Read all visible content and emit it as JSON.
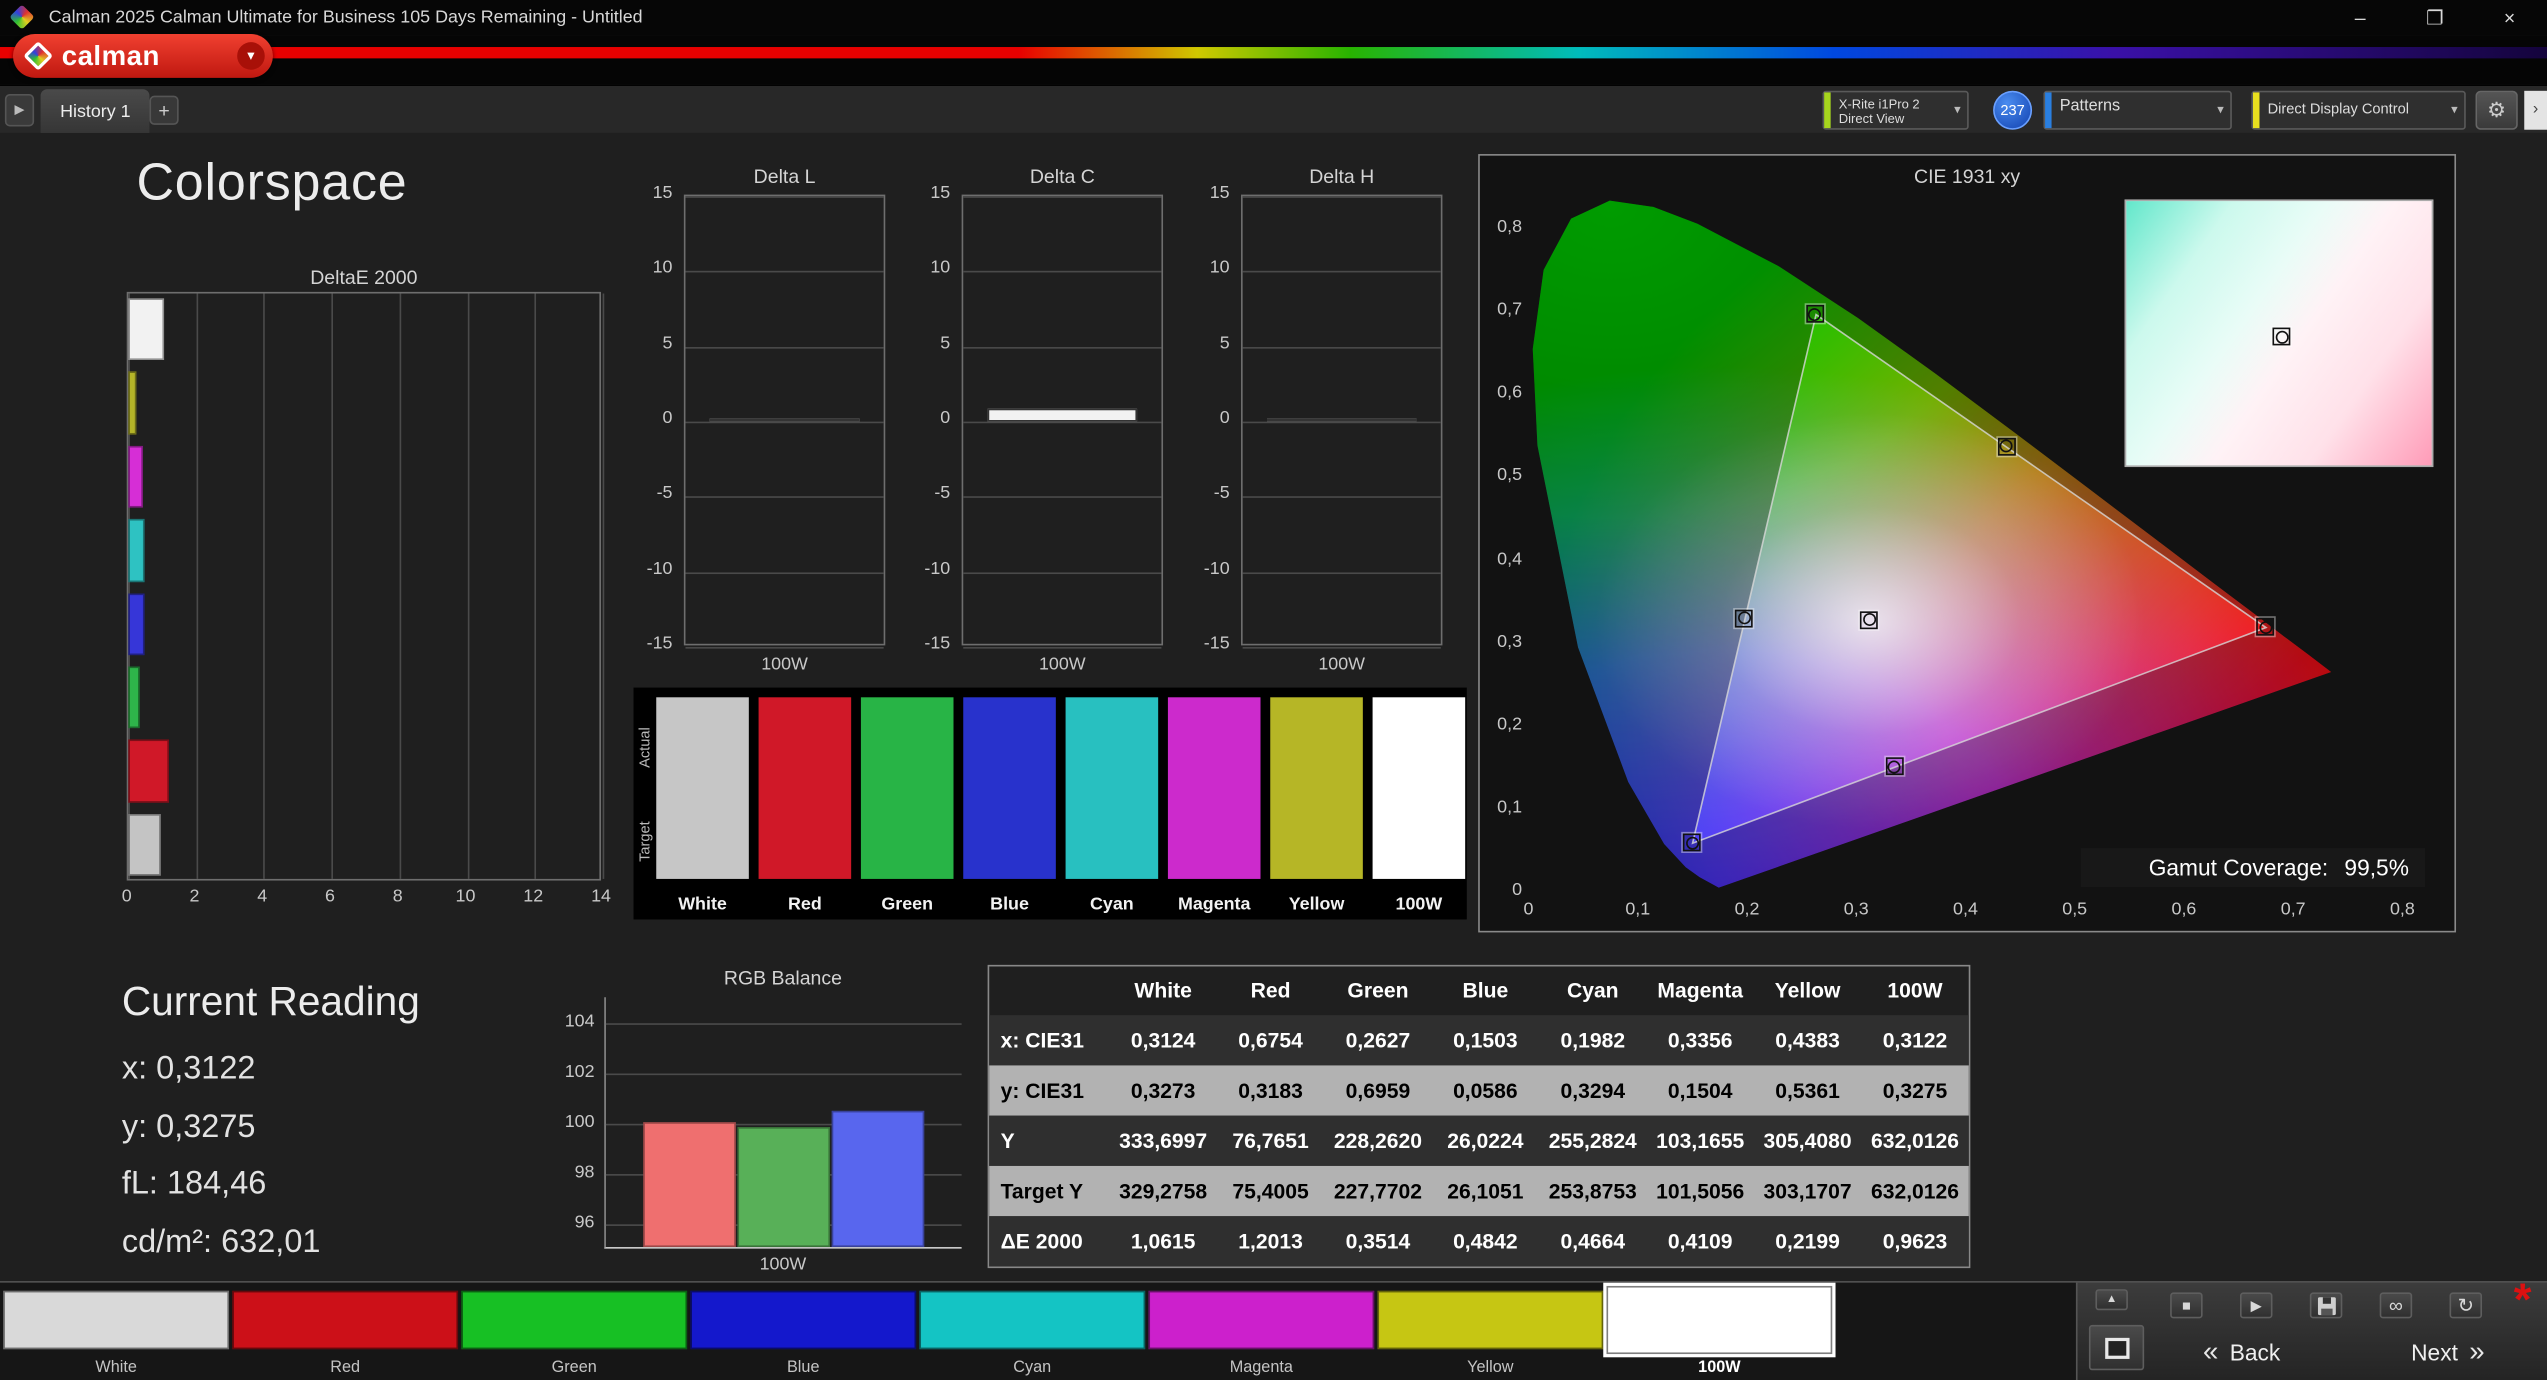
{
  "colors": {
    "accent_red": "#d62e20",
    "badge_blue": "#1e62d8",
    "meter_accent": "#a6d51e",
    "patterns_accent": "#2a7fe0",
    "display_accent": "#e8df1f"
  },
  "icons": {
    "chevron_down": "▾",
    "plus": "+",
    "panel_arrow": "▶",
    "gear": "⚙",
    "overflow": "›",
    "minimize": "–",
    "maximize": "❐",
    "close": "×",
    "up": "▲",
    "stop": "■",
    "play": "▶",
    "link": "∞",
    "refresh": "↻",
    "asterisk": "*",
    "back_chevron": "«",
    "next_chevron": "»"
  },
  "titlebar": {
    "title": "Calman 2025 Calman Ultimate for Business 105 Days Remaining  - Untitled"
  },
  "header": {
    "logo_text": "calman"
  },
  "tabbar": {
    "tab_label": "History 1",
    "meter_line1": "X-Rite i1Pro 2",
    "meter_line2": "Direct View",
    "meter_badge": "237",
    "patterns_label": "Patterns",
    "display_label": "Direct Display Control"
  },
  "page_title": "Colorspace",
  "swatch_strip": {
    "row_labels": [
      "Actual",
      "Target"
    ],
    "columns": [
      {
        "label": "White",
        "color": "#c6c6c6"
      },
      {
        "label": "Red",
        "color": "#d01828"
      },
      {
        "label": "Green",
        "color": "#28b446"
      },
      {
        "label": "Blue",
        "color": "#2832cc"
      },
      {
        "label": "Cyan",
        "color": "#28c0c0"
      },
      {
        "label": "Magenta",
        "color": "#cc2acc"
      },
      {
        "label": "Yellow",
        "color": "#b6b626"
      },
      {
        "label": "100W",
        "color": "#ffffff"
      }
    ]
  },
  "current_reading": {
    "title": "Current Reading",
    "x": "x: 0,3122",
    "y": "y: 0,3275",
    "fl": "fL: 184,46",
    "cd": "cd/m²: 632,01"
  },
  "table": {
    "columns": [
      "White",
      "Red",
      "Green",
      "Blue",
      "Cyan",
      "Magenta",
      "Yellow",
      "100W"
    ],
    "rows": [
      {
        "label": "x: CIE31",
        "values": [
          "0,3124",
          "0,6754",
          "0,2627",
          "0,1503",
          "0,1982",
          "0,3356",
          "0,4383",
          "0,3122"
        ]
      },
      {
        "label": "y: CIE31",
        "values": [
          "0,3273",
          "0,3183",
          "0,6959",
          "0,0586",
          "0,3294",
          "0,1504",
          "0,5361",
          "0,3275"
        ]
      },
      {
        "label": "Y",
        "values": [
          "333,6997",
          "76,7651",
          "228,2620",
          "26,0224",
          "255,2824",
          "103,1655",
          "305,4080",
          "632,0126"
        ]
      },
      {
        "label": "Target Y",
        "values": [
          "329,2758",
          "75,4005",
          "227,7702",
          "26,1051",
          "253,8753",
          "101,5056",
          "303,1707",
          "632,0126"
        ]
      },
      {
        "label": "ΔE 2000",
        "values": [
          "1,0615",
          "1,2013",
          "0,3514",
          "0,4842",
          "0,4664",
          "0,4109",
          "0,2199",
          "0,9623"
        ]
      }
    ]
  },
  "bottom_bar": {
    "swatches": [
      {
        "label": "White",
        "color": "#d9d9d9",
        "selected": false
      },
      {
        "label": "Red",
        "color": "#cc1018",
        "selected": false
      },
      {
        "label": "Green",
        "color": "#17c024",
        "selected": false
      },
      {
        "label": "Blue",
        "color": "#1418cc",
        "selected": false
      },
      {
        "label": "Cyan",
        "color": "#14c4c4",
        "selected": false
      },
      {
        "label": "Magenta",
        "color": "#cc20cc",
        "selected": false
      },
      {
        "label": "Yellow",
        "color": "#c6c613",
        "selected": false
      },
      {
        "label": "100W",
        "color": "#ffffff",
        "selected": true
      }
    ],
    "back_label": "Back",
    "next_label": "Next"
  },
  "chart_data": [
    {
      "id": "deltae",
      "type": "bar",
      "title": "DeltaE 2000",
      "categories": [
        "White",
        "Yellow",
        "Magenta",
        "Cyan",
        "Blue",
        "Green",
        "Red",
        "100W"
      ],
      "values": [
        1.0615,
        0.2199,
        0.4109,
        0.4664,
        0.4842,
        0.3514,
        1.2013,
        0.9623
      ],
      "bar_colors": [
        "#f2f2f2",
        "#b4b428",
        "#d62ed6",
        "#2ec2c2",
        "#3636d8",
        "#2eb44a",
        "#d01828",
        "#c4c4c4"
      ],
      "xlim": [
        0,
        14
      ],
      "x_ticks": [
        0,
        2,
        4,
        6,
        8,
        10,
        12,
        14
      ]
    },
    {
      "id": "delta_l",
      "type": "bar",
      "title": "Delta L",
      "categories": [
        "100W"
      ],
      "values": [
        0.05
      ],
      "ylim": [
        -15,
        15
      ],
      "y_ticks": [
        15,
        10,
        5,
        0,
        -5,
        -10,
        -15
      ],
      "xlabel": "100W"
    },
    {
      "id": "delta_c",
      "type": "bar",
      "title": "Delta C",
      "categories": [
        "100W"
      ],
      "values": [
        0.9
      ],
      "ylim": [
        -15,
        15
      ],
      "y_ticks": [
        15,
        10,
        5,
        0,
        -5,
        -10,
        -15
      ],
      "xlabel": "100W"
    },
    {
      "id": "delta_h",
      "type": "bar",
      "title": "Delta H",
      "categories": [
        "100W"
      ],
      "values": [
        0.1
      ],
      "ylim": [
        -15,
        15
      ],
      "y_ticks": [
        15,
        10,
        5,
        0,
        -5,
        -10,
        -15
      ],
      "xlabel": "100W"
    },
    {
      "id": "rgb_balance",
      "type": "bar",
      "title": "RGB Balance",
      "categories": [
        "Red",
        "Green",
        "Blue"
      ],
      "values": [
        100.0,
        99.8,
        100.45
      ],
      "bar_colors": [
        "#ef6f6f",
        "#58b058",
        "#5866ee"
      ],
      "ylim": [
        95,
        105
      ],
      "y_ticks": [
        104,
        102,
        100,
        98,
        96
      ],
      "xlabel": "100W"
    },
    {
      "id": "cie",
      "type": "scatter",
      "title": "CIE 1931 xy",
      "xlim": [
        0,
        0.8
      ],
      "ylim": [
        0,
        0.835
      ],
      "x_tick_labels": [
        "0",
        "0,1",
        "0,2",
        "0,3",
        "0,4",
        "0,5",
        "0,6",
        "0,7",
        "0,8"
      ],
      "y_tick_labels": [
        "0",
        "0,1",
        "0,2",
        "0,3",
        "0,4",
        "0,5",
        "0,6",
        "0,7",
        "0,8"
      ],
      "points": [
        {
          "name": "white",
          "x": 0.3124,
          "y": 0.3273
        },
        {
          "name": "red",
          "x": 0.6754,
          "y": 0.3183
        },
        {
          "name": "green",
          "x": 0.2627,
          "y": 0.6959
        },
        {
          "name": "blue",
          "x": 0.1503,
          "y": 0.0586
        },
        {
          "name": "cyan",
          "x": 0.1982,
          "y": 0.3294
        },
        {
          "name": "magenta",
          "x": 0.3356,
          "y": 0.1504
        },
        {
          "name": "yellow",
          "x": 0.4383,
          "y": 0.5361
        }
      ],
      "gamut_label": "Gamut Coverage:",
      "gamut_value": "99,5%"
    }
  ]
}
